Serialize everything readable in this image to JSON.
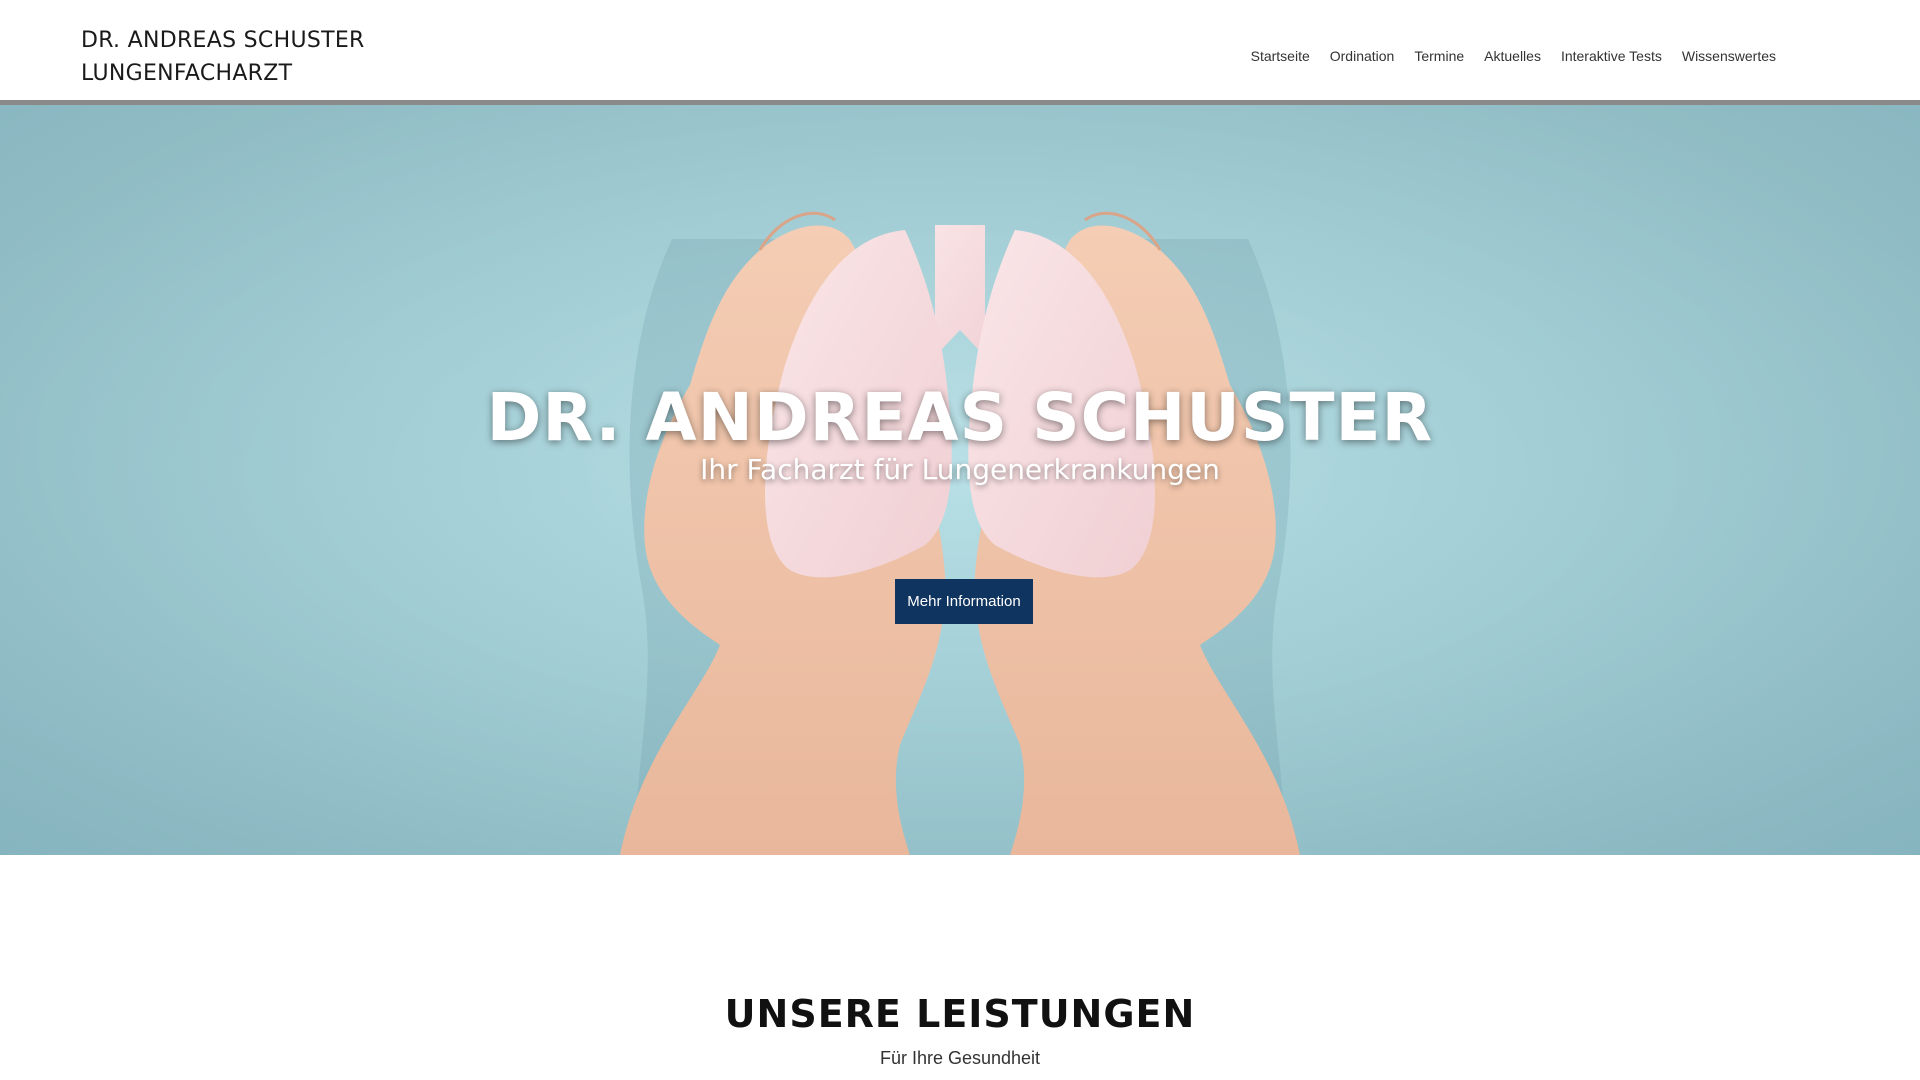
{
  "header": {
    "brand_line1": "DR. ANDREAS SCHUSTER",
    "brand_line2": "LUNGENFACHARZT",
    "nav": [
      {
        "label": "Startseite"
      },
      {
        "label": "Ordination"
      },
      {
        "label": "Termine"
      },
      {
        "label": "Aktuelles"
      },
      {
        "label": "Interaktive Tests"
      },
      {
        "label": "Wissenswertes"
      }
    ]
  },
  "hero": {
    "title": "DR. ANDREAS SCHUSTER",
    "subtitle": "Ihr Facharzt für Lungenerkrankungen",
    "button_label": "Mehr Information",
    "image_icon": "hands-holding-paper-lungs-image"
  },
  "services": {
    "title": "UNSERE LEISTUNGEN",
    "subtitle": "Für Ihre Gesundheit"
  },
  "colors": {
    "hero_background": "#a9d6de",
    "button_background": "#0f3460",
    "lung_pink": "#f6dde0",
    "skin": "#f1c6ad",
    "header_rule": "#8a8a8a"
  }
}
